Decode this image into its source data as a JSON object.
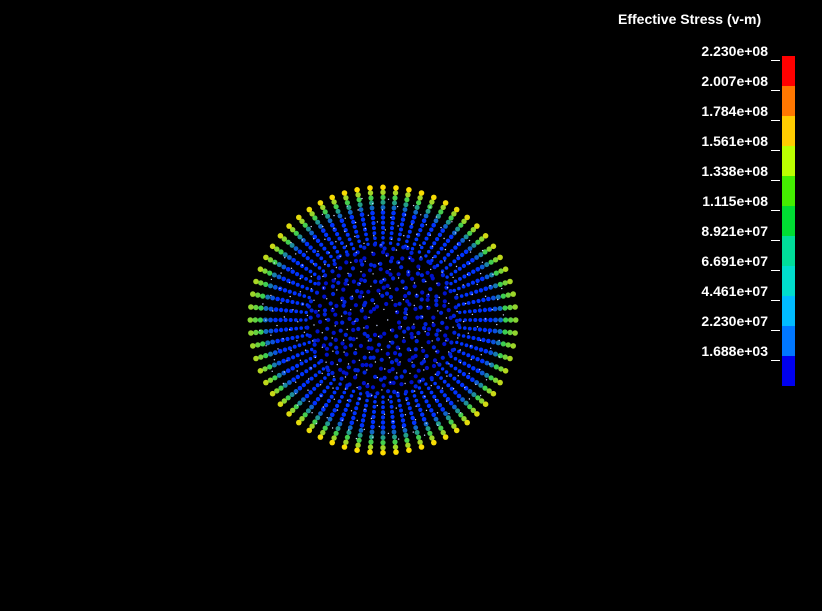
{
  "legend": {
    "title": "Effective Stress (v-m)",
    "levels": [
      {
        "label": "2.230e+08",
        "color": "#ff0000"
      },
      {
        "label": "2.007e+08",
        "color": "#ff7700"
      },
      {
        "label": "1.784e+08",
        "color": "#ffcc00"
      },
      {
        "label": "1.561e+08",
        "color": "#bbff00"
      },
      {
        "label": "1.338e+08",
        "color": "#44ee00"
      },
      {
        "label": "1.115e+08",
        "color": "#00dd33"
      },
      {
        "label": "8.921e+07",
        "color": "#00dd99"
      },
      {
        "label": "6.691e+07",
        "color": "#00ddcc"
      },
      {
        "label": "4.461e+07",
        "color": "#00bbff"
      },
      {
        "label": "2.230e+07",
        "color": "#0077ff"
      },
      {
        "label": "1.688e+03",
        "color": "#0000ee"
      }
    ]
  },
  "model": {
    "rings": 8,
    "spokes": 64,
    "outer_stress_color": "#ffdd00",
    "mid_stress_color": "#33cc55",
    "low_stress_color": "#0033ff",
    "core_color": "#0011cc"
  }
}
